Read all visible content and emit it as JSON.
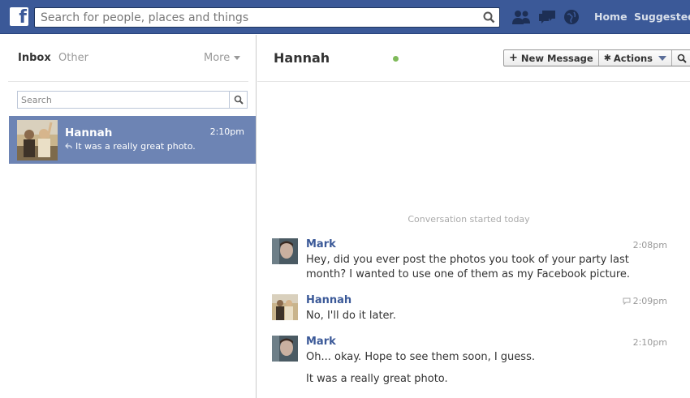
{
  "topbar": {
    "logo_letter": "f",
    "search_placeholder": "Search for people, places and things",
    "icons": [
      "friend-requests-icon",
      "messages-icon",
      "notifications-icon"
    ],
    "links": {
      "home": "Home",
      "suggested": "Suggested F"
    }
  },
  "sidebar": {
    "tabs": {
      "inbox": "Inbox",
      "other": "Other"
    },
    "more_label": "More",
    "search_placeholder": "Search",
    "threads": [
      {
        "name": "Hannah",
        "time": "2:10pm",
        "snippet": "It was a really great photo."
      }
    ]
  },
  "conversation": {
    "title": "Hannah",
    "buttons": {
      "new_message": "New Message",
      "actions": "Actions"
    },
    "started_label": "Conversation started today",
    "messages": [
      {
        "author": "Mark",
        "time": "2:08pm",
        "body": "Hey, did you ever post the photos you took of your party last month? I wanted to use one of them as my Facebook picture."
      },
      {
        "author": "Hannah",
        "time": "2:09pm",
        "body": "No, I'll do it later."
      },
      {
        "author": "Mark",
        "time": "2:10pm",
        "body": "Oh... okay. Hope to see them soon, I guess.",
        "extra": "It was a really great photo."
      }
    ]
  },
  "colors": {
    "brand_blue": "#3b5998",
    "selected_thread": "#6d84b4",
    "online_green": "#7fba5a"
  }
}
